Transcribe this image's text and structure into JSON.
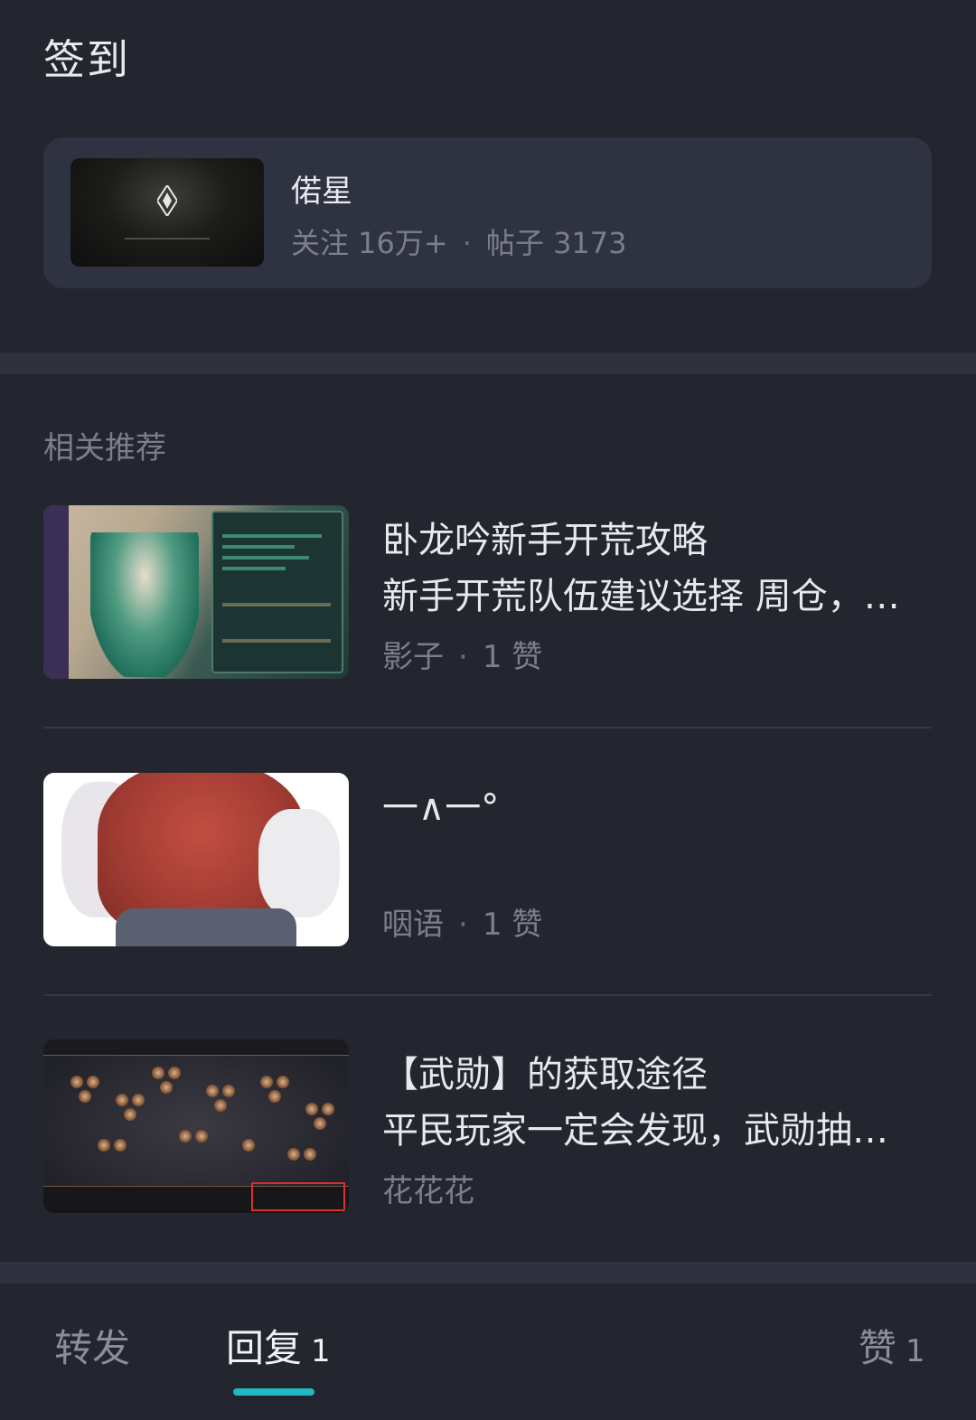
{
  "header": {
    "title": "签到"
  },
  "forum": {
    "name": "偌星",
    "followers_label": "关注 16万+",
    "posts_label": "帖子 3173"
  },
  "recommendations": {
    "heading": "相关推荐",
    "items": [
      {
        "title": "卧龙吟新手开荒攻略",
        "description": "新手开荒队伍建议选择 周仓，…",
        "author": "影子",
        "likes": "1 赞"
      },
      {
        "title": "一∧一°",
        "description": "",
        "author": "咽语",
        "likes": "1 赞"
      },
      {
        "title": "【武勋】的获取途径",
        "description": "平民玩家一定会发现，武勋抽…",
        "author": "花花花",
        "likes": ""
      }
    ]
  },
  "tabbar": {
    "tabs": [
      {
        "label": "转发",
        "count": ""
      },
      {
        "label": "回复",
        "count": "1"
      },
      {
        "label": "赞",
        "count": "1"
      }
    ],
    "accent_color": "#1fb8c3"
  }
}
